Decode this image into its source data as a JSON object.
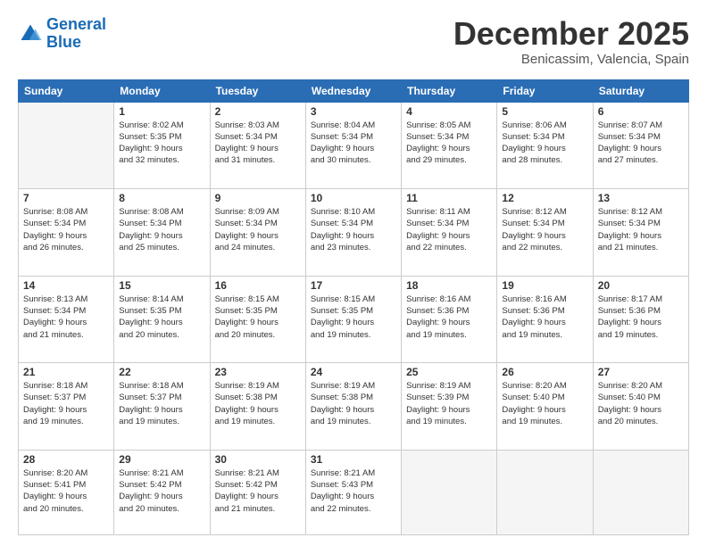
{
  "header": {
    "logo_general": "General",
    "logo_blue": "Blue",
    "title": "December 2025",
    "subtitle": "Benicassim, Valencia, Spain"
  },
  "weekdays": [
    "Sunday",
    "Monday",
    "Tuesday",
    "Wednesday",
    "Thursday",
    "Friday",
    "Saturday"
  ],
  "weeks": [
    [
      {
        "day": "",
        "info": ""
      },
      {
        "day": "1",
        "info": "Sunrise: 8:02 AM\nSunset: 5:35 PM\nDaylight: 9 hours\nand 32 minutes."
      },
      {
        "day": "2",
        "info": "Sunrise: 8:03 AM\nSunset: 5:34 PM\nDaylight: 9 hours\nand 31 minutes."
      },
      {
        "day": "3",
        "info": "Sunrise: 8:04 AM\nSunset: 5:34 PM\nDaylight: 9 hours\nand 30 minutes."
      },
      {
        "day": "4",
        "info": "Sunrise: 8:05 AM\nSunset: 5:34 PM\nDaylight: 9 hours\nand 29 minutes."
      },
      {
        "day": "5",
        "info": "Sunrise: 8:06 AM\nSunset: 5:34 PM\nDaylight: 9 hours\nand 28 minutes."
      },
      {
        "day": "6",
        "info": "Sunrise: 8:07 AM\nSunset: 5:34 PM\nDaylight: 9 hours\nand 27 minutes."
      }
    ],
    [
      {
        "day": "7",
        "info": "Sunrise: 8:08 AM\nSunset: 5:34 PM\nDaylight: 9 hours\nand 26 minutes."
      },
      {
        "day": "8",
        "info": "Sunrise: 8:08 AM\nSunset: 5:34 PM\nDaylight: 9 hours\nand 25 minutes."
      },
      {
        "day": "9",
        "info": "Sunrise: 8:09 AM\nSunset: 5:34 PM\nDaylight: 9 hours\nand 24 minutes."
      },
      {
        "day": "10",
        "info": "Sunrise: 8:10 AM\nSunset: 5:34 PM\nDaylight: 9 hours\nand 23 minutes."
      },
      {
        "day": "11",
        "info": "Sunrise: 8:11 AM\nSunset: 5:34 PM\nDaylight: 9 hours\nand 22 minutes."
      },
      {
        "day": "12",
        "info": "Sunrise: 8:12 AM\nSunset: 5:34 PM\nDaylight: 9 hours\nand 22 minutes."
      },
      {
        "day": "13",
        "info": "Sunrise: 8:12 AM\nSunset: 5:34 PM\nDaylight: 9 hours\nand 21 minutes."
      }
    ],
    [
      {
        "day": "14",
        "info": "Sunrise: 8:13 AM\nSunset: 5:34 PM\nDaylight: 9 hours\nand 21 minutes."
      },
      {
        "day": "15",
        "info": "Sunrise: 8:14 AM\nSunset: 5:35 PM\nDaylight: 9 hours\nand 20 minutes."
      },
      {
        "day": "16",
        "info": "Sunrise: 8:15 AM\nSunset: 5:35 PM\nDaylight: 9 hours\nand 20 minutes."
      },
      {
        "day": "17",
        "info": "Sunrise: 8:15 AM\nSunset: 5:35 PM\nDaylight: 9 hours\nand 19 minutes."
      },
      {
        "day": "18",
        "info": "Sunrise: 8:16 AM\nSunset: 5:36 PM\nDaylight: 9 hours\nand 19 minutes."
      },
      {
        "day": "19",
        "info": "Sunrise: 8:16 AM\nSunset: 5:36 PM\nDaylight: 9 hours\nand 19 minutes."
      },
      {
        "day": "20",
        "info": "Sunrise: 8:17 AM\nSunset: 5:36 PM\nDaylight: 9 hours\nand 19 minutes."
      }
    ],
    [
      {
        "day": "21",
        "info": "Sunrise: 8:18 AM\nSunset: 5:37 PM\nDaylight: 9 hours\nand 19 minutes."
      },
      {
        "day": "22",
        "info": "Sunrise: 8:18 AM\nSunset: 5:37 PM\nDaylight: 9 hours\nand 19 minutes."
      },
      {
        "day": "23",
        "info": "Sunrise: 8:19 AM\nSunset: 5:38 PM\nDaylight: 9 hours\nand 19 minutes."
      },
      {
        "day": "24",
        "info": "Sunrise: 8:19 AM\nSunset: 5:38 PM\nDaylight: 9 hours\nand 19 minutes."
      },
      {
        "day": "25",
        "info": "Sunrise: 8:19 AM\nSunset: 5:39 PM\nDaylight: 9 hours\nand 19 minutes."
      },
      {
        "day": "26",
        "info": "Sunrise: 8:20 AM\nSunset: 5:40 PM\nDaylight: 9 hours\nand 19 minutes."
      },
      {
        "day": "27",
        "info": "Sunrise: 8:20 AM\nSunset: 5:40 PM\nDaylight: 9 hours\nand 20 minutes."
      }
    ],
    [
      {
        "day": "28",
        "info": "Sunrise: 8:20 AM\nSunset: 5:41 PM\nDaylight: 9 hours\nand 20 minutes."
      },
      {
        "day": "29",
        "info": "Sunrise: 8:21 AM\nSunset: 5:42 PM\nDaylight: 9 hours\nand 20 minutes."
      },
      {
        "day": "30",
        "info": "Sunrise: 8:21 AM\nSunset: 5:42 PM\nDaylight: 9 hours\nand 21 minutes."
      },
      {
        "day": "31",
        "info": "Sunrise: 8:21 AM\nSunset: 5:43 PM\nDaylight: 9 hours\nand 22 minutes."
      },
      {
        "day": "",
        "info": ""
      },
      {
        "day": "",
        "info": ""
      },
      {
        "day": "",
        "info": ""
      }
    ]
  ]
}
